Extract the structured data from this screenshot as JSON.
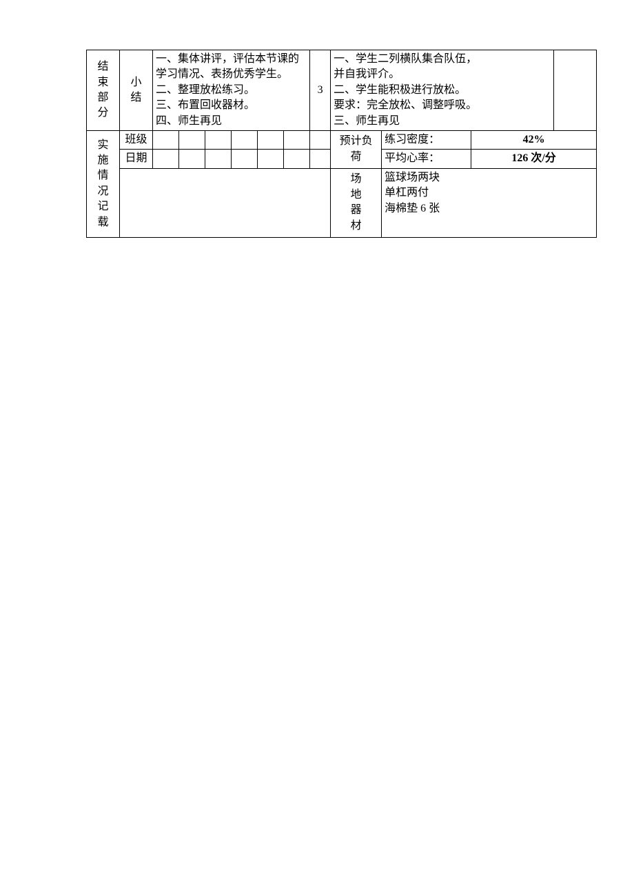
{
  "row1": {
    "sectionLabel": "结束部分",
    "sub": "小结",
    "content": "一、集体讲评，评估本节课的学习情况、表扬优秀学生。\n二、整理放松练习。\n三、布置回收器材。\n四、师生再见",
    "num": "3",
    "right": "一、学生二列横队集合队伍，并自我评介。\n二、学生能积极进行放松。\n要求：完全放松、调整呼吸。\n三、师生再见"
  },
  "implLabel": "实施情况记载",
  "classLabel": "班级",
  "dateLabel": "日期",
  "loadLabel": "预计负荷",
  "densityLabel": "练习密度：",
  "densityValue": "42%",
  "hrLabel": "平均心率：",
  "hrValue": "126 次/分",
  "venueLabel": "场地器材",
  "venueContent": "篮球场两块\n单杠两付\n海棉垫 6 张"
}
